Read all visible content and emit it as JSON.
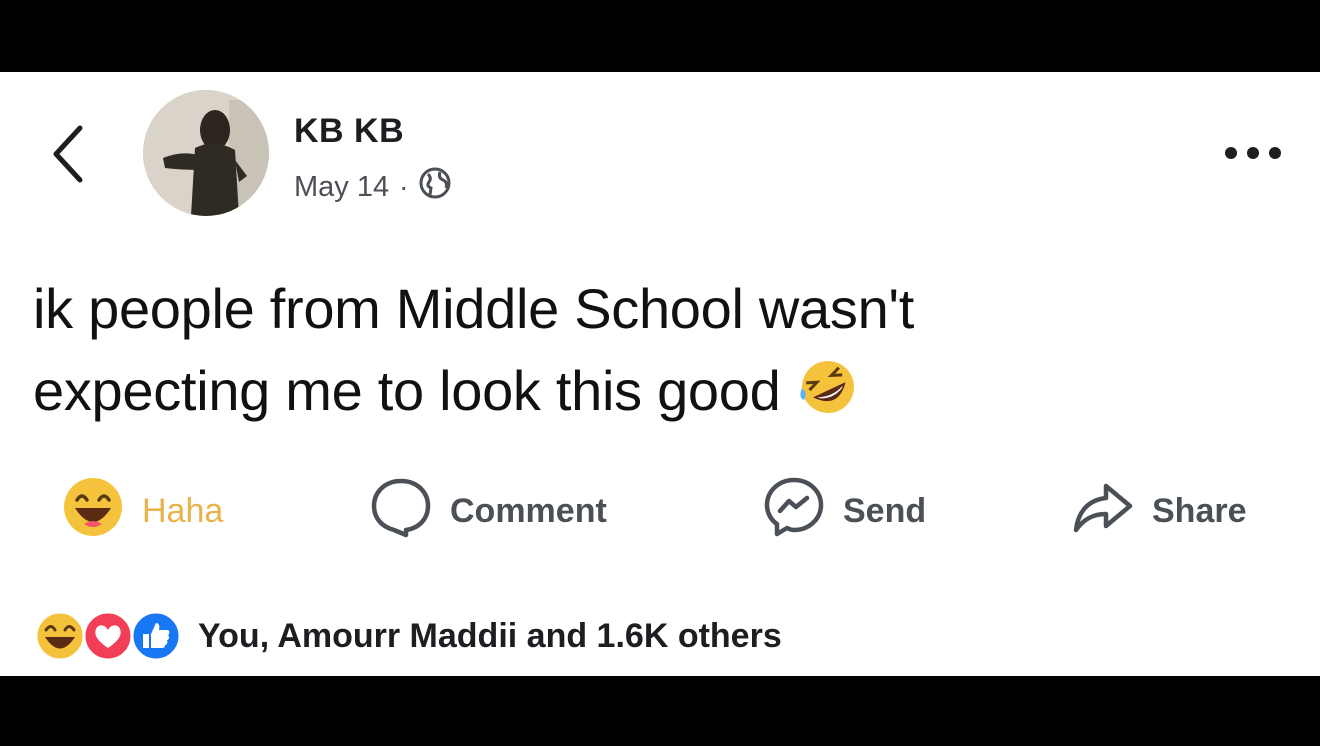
{
  "post": {
    "author": "KB KB",
    "date": "May 14",
    "separator": "·",
    "privacy_icon": "globe-icon",
    "text_line1": "ik people from Middle School wasn't",
    "text_line2": "expecting me to look this good",
    "text_emoji": "rolling-on-floor-laughing-emoji"
  },
  "actions": {
    "haha_label": "Haha",
    "comment_label": "Comment",
    "send_label": "Send",
    "share_label": "Share"
  },
  "reactions": {
    "icons": [
      "haha-icon",
      "love-icon",
      "like-icon"
    ],
    "summary": "You, Amourr Maddii and 1.6K others"
  },
  "colors": {
    "haha_yellow": "#f5c33b",
    "love_red": "#f33e58",
    "like_blue": "#1877f2",
    "text": "#1c1e21",
    "muted": "#4b4f56"
  }
}
